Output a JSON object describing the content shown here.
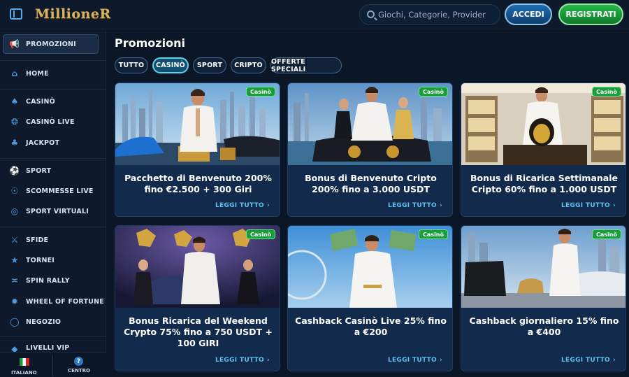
{
  "header": {
    "logo": "MillioneR",
    "search_placeholder": "Giochi, Categorie, Provider",
    "login_label": "ACCEDI",
    "register_label": "REGISTRATI"
  },
  "sidebar": {
    "items": [
      {
        "label": "PROMOZIONI",
        "icon": "megaphone-icon",
        "active": true
      },
      {
        "label": "HOME",
        "icon": "home-icon"
      },
      {
        "label": "CASINÒ",
        "icon": "spade-icon"
      },
      {
        "label": "CASINÒ LIVE",
        "icon": "chip-icon"
      },
      {
        "label": "JACKPOT",
        "icon": "clover-icon"
      },
      {
        "label": "SPORT",
        "icon": "soccer-ball-icon"
      },
      {
        "label": "SCOMMESSE LIVE",
        "icon": "coin-icon"
      },
      {
        "label": "SPORT VIRTUALI",
        "icon": "target-icon"
      },
      {
        "label": "SFIDE",
        "icon": "swords-icon"
      },
      {
        "label": "TORNEI",
        "icon": "medal-icon"
      },
      {
        "label": "SPIN RALLY",
        "icon": "rally-icon"
      },
      {
        "label": "WHEEL OF FORTUNE",
        "icon": "wheel-icon"
      },
      {
        "label": "NEGOZIO",
        "icon": "basket-icon"
      },
      {
        "label": "LIVELLI VIP",
        "icon": "vip-icon"
      }
    ],
    "footer": {
      "language": "ITALIANO",
      "help": "CENTRO"
    }
  },
  "main": {
    "title": "Promozioni",
    "tabs": [
      {
        "label": "TUTTO"
      },
      {
        "label": "CASINÒ",
        "active": true
      },
      {
        "label": "SPORT"
      },
      {
        "label": "CRIPTO"
      },
      {
        "label": "OFFERTE SPECIALI"
      }
    ],
    "cards": [
      {
        "badge": "Casinò",
        "title": "Pacchetto di Benvenuto 200% fino €2.500 + 300 Giri",
        "link": "LEGGI TUTTO"
      },
      {
        "badge": "Casinò",
        "title": "Bonus di Benvenuto Cripto 200% fino a 3.000 USDT",
        "link": "LEGGI TUTTO"
      },
      {
        "badge": "Casinò",
        "title": "Bonus di Ricarica Settimanale Cripto 60% fino a 1.000 USDT",
        "link": "LEGGI TUTTO"
      },
      {
        "badge": "Casinò",
        "title": "Bonus Ricarica del Weekend Crypto 75% fino a 750 USDT + 100 GIRI",
        "link": "LEGGI TUTTO"
      },
      {
        "badge": "Casinò",
        "title": "Cashback Casinò Live 25% fino a €200",
        "link": "LEGGI TUTTO"
      },
      {
        "badge": "Casinò",
        "title": "Cashback giornaliero 15% fino a €400",
        "link": "LEGGI TUTTO"
      }
    ]
  },
  "colors": {
    "background": "#0b1626",
    "accent_blue": "#5fc1ef",
    "badge_green": "#1a9e3d",
    "register_green": "#27b64a",
    "logo_gold": "#d9b35e"
  }
}
